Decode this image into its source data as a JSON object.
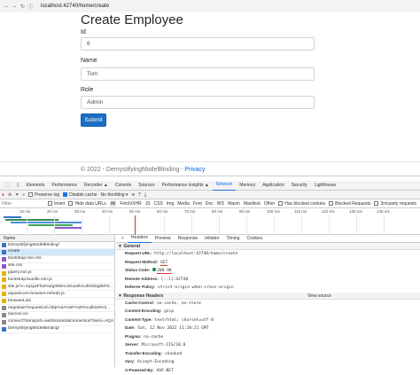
{
  "browser": {
    "url": "localhost:42740/home/create"
  },
  "page": {
    "title": "Create Employee",
    "fields": [
      {
        "label": "Id",
        "value": "6"
      },
      {
        "label": "Name",
        "value": "Tom"
      },
      {
        "label": "Role",
        "value": "Admin"
      }
    ],
    "submit_label": "Submit",
    "footer_text": "© 2022 - DemystifyingModelBinding -",
    "footer_link": "Privacy"
  },
  "devtools": {
    "tabs": [
      "Elements",
      "Performance",
      "Recorder ▲",
      "Console",
      "Sources",
      "Performance insights ▲",
      "Network",
      "Memory",
      "Application",
      "Security",
      "Lighthouse"
    ],
    "active_tab": "Network",
    "toolbar1": {
      "preserve_log": "Preserve log",
      "disable_cache": "Disable cache",
      "throttle": "No throttling"
    },
    "toolbar2": {
      "filter_label": "Filter",
      "invert": "Invert",
      "hide_data_urls": "Hide data URLs",
      "types": [
        "All",
        "Fetch/XHR",
        "JS",
        "CSS",
        "Img",
        "Media",
        "Font",
        "Doc",
        "WS",
        "Wasm",
        "Manifest",
        "Other"
      ],
      "has_blocked_cookies": "Has blocked cookies",
      "blocked_requests": "Blocked Requests",
      "third_party": "3rd-party requests"
    },
    "timeline_ticks": [
      "10 ms",
      "20 ms",
      "30 ms",
      "40 ms",
      "50 ms",
      "60 ms",
      "70 ms",
      "80 ms",
      "90 ms",
      "100 ms",
      "110 ms",
      "120 ms",
      "130 ms",
      "140 ms"
    ],
    "files_header": "Name",
    "files": [
      {
        "name": "DemystifyingModelBinding/",
        "color": "#3b73c8"
      },
      {
        "name": "create",
        "color": "#3b73c8",
        "selected": true
      },
      {
        "name": "bootstrap.min.css",
        "color": "#9155c6"
      },
      {
        "name": "site.css",
        "color": "#9155c6"
      },
      {
        "name": "jquery.min.js",
        "color": "#e4b10c"
      },
      {
        "name": "bootstrap.bundle.min.js",
        "color": "#e4b10c"
      },
      {
        "name": "site.js?v=4q1jwFhaPaZgr8WAUSrux6hAuh0XDg9kPS...",
        "color": "#e4b10c"
      },
      {
        "name": "aspnetcore-browser-refresh.js",
        "color": "#e4b10c"
      },
      {
        "name": "browserLink",
        "color": "#e4b10c"
      },
      {
        "name": "negotiate?requestUrl=http%3A%2F%2Flocalhost%3...",
        "color": "#888888"
      },
      {
        "name": "favicon.ico",
        "color": "#888888"
      },
      {
        "name": "connect?transport=webSockets&connectionToken=AQA...",
        "color": "#888888"
      },
      {
        "name": "DemystifyingModelBinding/",
        "color": "#3b73c8"
      }
    ],
    "detail_tabs": [
      "×",
      "Headers",
      "Preview",
      "Response",
      "Initiator",
      "Timing",
      "Cookies"
    ],
    "active_detail_tab": "Headers",
    "general_title": "▼ General",
    "general": [
      {
        "key": "Request URL:",
        "value": "http://localhost:42740/home/create"
      },
      {
        "key": "Request Method:",
        "value": "GET"
      },
      {
        "key": "Status Code:",
        "value": "200 OK"
      },
      {
        "key": "Remote Address:",
        "value": "[::1]:42740"
      },
      {
        "key": "Referrer Policy:",
        "value": "strict-origin-when-cross-origin"
      }
    ],
    "response_title": "▼ Response Headers",
    "view_source": "View source",
    "response_headers": [
      {
        "key": "Cache-Control:",
        "value": "no-cache, no-store"
      },
      {
        "key": "Content-Encoding:",
        "value": "gzip"
      },
      {
        "key": "Content-Type:",
        "value": "text/html; charset=utf-8"
      },
      {
        "key": "Date:",
        "value": "Sat, 12 Nov 2022 11:20:21 GMT"
      },
      {
        "key": "Pragma:",
        "value": "no-cache"
      },
      {
        "key": "Server:",
        "value": "Microsoft-IIS/10.0"
      },
      {
        "key": "Transfer-Encoding:",
        "value": "chunked"
      },
      {
        "key": "Vary:",
        "value": "Accept-Encoding"
      },
      {
        "key": "X-Powered-By:",
        "value": "ASP.NET"
      }
    ]
  }
}
